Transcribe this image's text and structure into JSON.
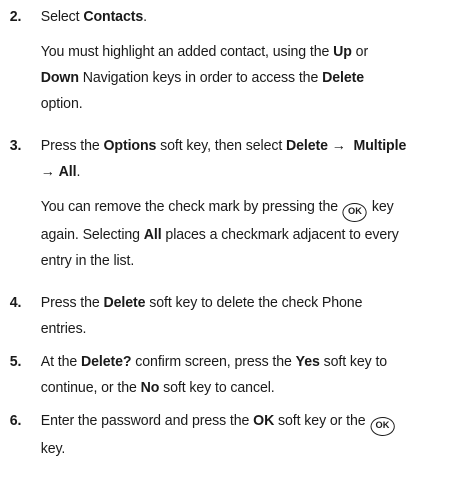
{
  "steps": [
    {
      "number": "2.",
      "text": {
        "a": "Select ",
        "b1": "Contacts",
        "c": "."
      },
      "note": {
        "a": "You must highlight an added contact, using the ",
        "b1": "Up",
        "c": " or",
        "b2": "Down",
        "d": " Navigation keys in order to access the ",
        "b3": "Delete",
        "e": "option."
      }
    },
    {
      "number": "3.",
      "text": {
        "a": "Press the ",
        "b1": "Options",
        "c": " soft key, then select ",
        "b2": "Delete",
        "arrow1": "→",
        "b3": "Multiple",
        "arrow2": "→",
        "b4": "All",
        "d": "."
      },
      "note": {
        "a": "You can remove the check mark by pressing the ",
        "key": "OK",
        "b": " key",
        "c": "again. Selecting ",
        "b1": "All",
        "d": " places a checkmark adjacent to every",
        "e": "entry in the list."
      }
    },
    {
      "number": "4.",
      "text": {
        "a": "Press the ",
        "b1": "Delete",
        "c": " soft key to delete the check Phone",
        "d": "entries."
      }
    },
    {
      "number": "5.",
      "text": {
        "a": "At the ",
        "b1": "Delete?",
        "c": " confirm screen, press the ",
        "b2": "Yes",
        "d": " soft key to",
        "e": "continue, or the ",
        "b3": "No",
        "f": " soft key to cancel."
      }
    },
    {
      "number": "6.",
      "text": {
        "a": "Enter the password and press the ",
        "b1": "OK",
        "c": " soft key or the ",
        "key": "OK",
        "d": "key."
      }
    }
  ]
}
